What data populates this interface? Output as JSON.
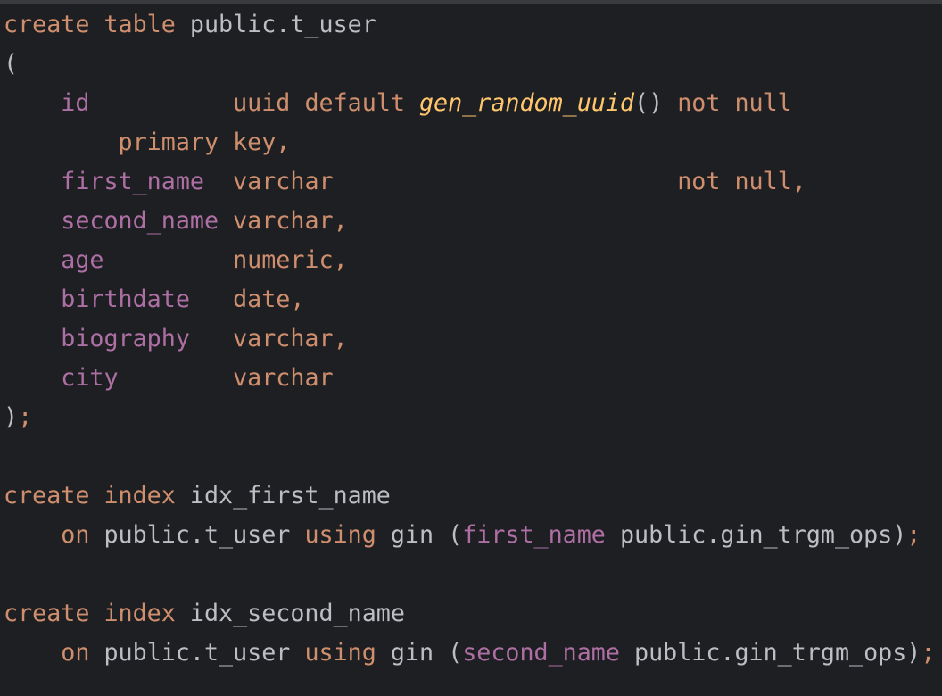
{
  "editor": {
    "language": "SQL",
    "lines": [
      [
        {
          "t": "create",
          "c": "kw"
        },
        {
          "t": " ",
          "c": "id"
        },
        {
          "t": "table",
          "c": "kw"
        },
        {
          "t": " public.t_user",
          "c": "id"
        }
      ],
      [
        {
          "t": "(",
          "c": "pun"
        }
      ],
      [
        {
          "t": "    ",
          "c": "id"
        },
        {
          "t": "id",
          "c": "col"
        },
        {
          "t": "          ",
          "c": "id"
        },
        {
          "t": "uuid default ",
          "c": "kw"
        },
        {
          "t": "gen_random_uuid",
          "c": "fn"
        },
        {
          "t": "()",
          "c": "pun"
        },
        {
          "t": " not null",
          "c": "kw"
        }
      ],
      [
        {
          "t": "        ",
          "c": "id"
        },
        {
          "t": "primary key",
          "c": "kw"
        },
        {
          "t": ",",
          "c": "kw"
        }
      ],
      [
        {
          "t": "    ",
          "c": "id"
        },
        {
          "t": "first_name",
          "c": "col"
        },
        {
          "t": "  ",
          "c": "id"
        },
        {
          "t": "varchar",
          "c": "kw"
        },
        {
          "t": "                        ",
          "c": "id"
        },
        {
          "t": "not null,",
          "c": "kw"
        }
      ],
      [
        {
          "t": "    ",
          "c": "id"
        },
        {
          "t": "second_name",
          "c": "col"
        },
        {
          "t": " ",
          "c": "id"
        },
        {
          "t": "varchar,",
          "c": "kw"
        }
      ],
      [
        {
          "t": "    ",
          "c": "id"
        },
        {
          "t": "age",
          "c": "col"
        },
        {
          "t": "         ",
          "c": "id"
        },
        {
          "t": "numeric,",
          "c": "kw"
        }
      ],
      [
        {
          "t": "    ",
          "c": "id"
        },
        {
          "t": "birthdate",
          "c": "col"
        },
        {
          "t": "   ",
          "c": "id"
        },
        {
          "t": "date,",
          "c": "kw"
        }
      ],
      [
        {
          "t": "    ",
          "c": "id"
        },
        {
          "t": "biography",
          "c": "col"
        },
        {
          "t": "   ",
          "c": "id"
        },
        {
          "t": "varchar,",
          "c": "kw"
        }
      ],
      [
        {
          "t": "    ",
          "c": "id"
        },
        {
          "t": "city",
          "c": "col"
        },
        {
          "t": "        ",
          "c": "id"
        },
        {
          "t": "varchar",
          "c": "kw"
        }
      ],
      [
        {
          "t": ")",
          "c": "pun"
        },
        {
          "t": ";",
          "c": "semi"
        }
      ],
      [],
      [
        {
          "t": "create",
          "c": "kw"
        },
        {
          "t": " ",
          "c": "id"
        },
        {
          "t": "index",
          "c": "kw"
        },
        {
          "t": " idx_first_name",
          "c": "id"
        }
      ],
      [
        {
          "t": "    ",
          "c": "id"
        },
        {
          "t": "on",
          "c": "kw"
        },
        {
          "t": " public.t_user ",
          "c": "id"
        },
        {
          "t": "using",
          "c": "kw"
        },
        {
          "t": " gin (",
          "c": "id"
        },
        {
          "t": "first_name",
          "c": "col"
        },
        {
          "t": " public.gin_trgm_ops)",
          "c": "id"
        },
        {
          "t": ";",
          "c": "semi"
        }
      ],
      [],
      [
        {
          "t": "create",
          "c": "kw"
        },
        {
          "t": " ",
          "c": "id"
        },
        {
          "t": "index",
          "c": "kw"
        },
        {
          "t": " idx_second_name",
          "c": "id"
        }
      ],
      [
        {
          "t": "    ",
          "c": "id"
        },
        {
          "t": "on",
          "c": "kw"
        },
        {
          "t": " public.t_user ",
          "c": "id"
        },
        {
          "t": "using",
          "c": "kw"
        },
        {
          "t": " gin (",
          "c": "id"
        },
        {
          "t": "second_name",
          "c": "col"
        },
        {
          "t": " public.gin_trgm_ops)",
          "c": "id"
        },
        {
          "t": ";",
          "c": "semi"
        }
      ]
    ]
  }
}
